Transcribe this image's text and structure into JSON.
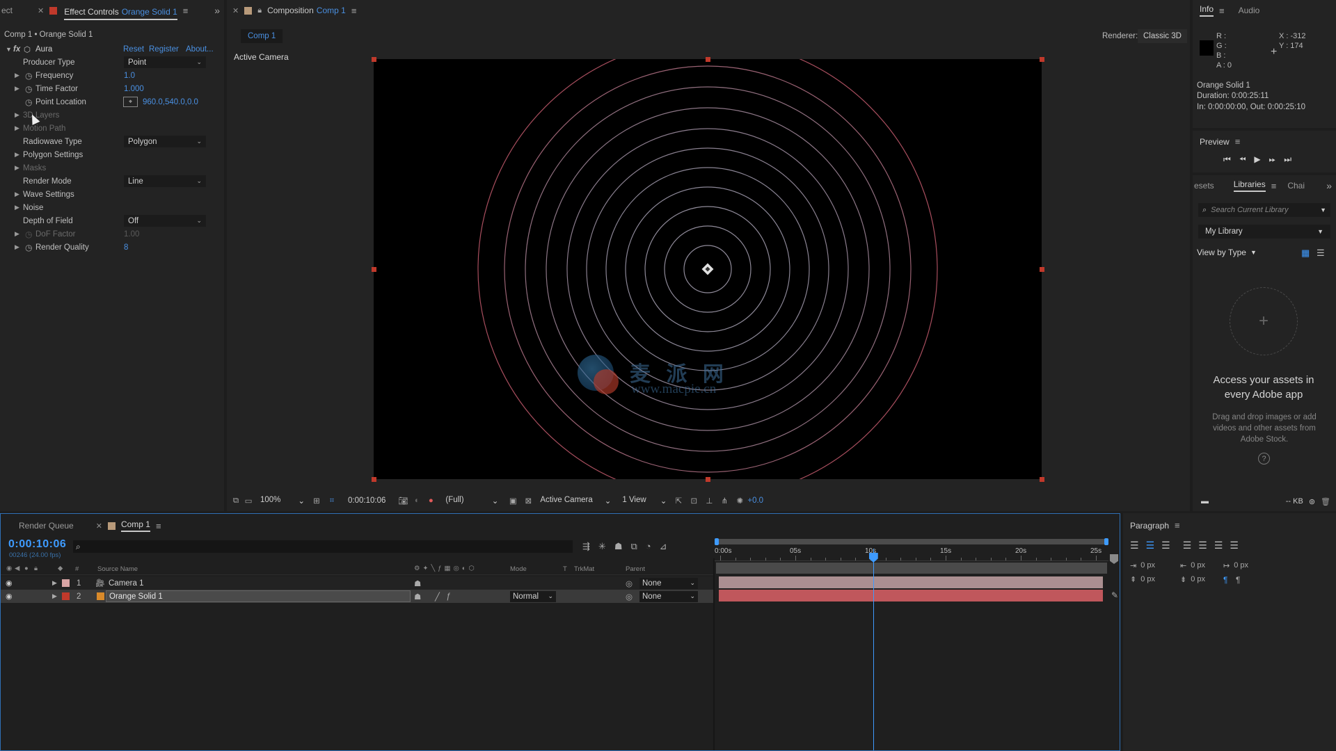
{
  "effect_controls": {
    "tabs": {
      "prev_tab": "ect",
      "title": "Effect Controls",
      "layer_name": "Orange Solid 1"
    },
    "breadcrumb": "Comp 1 • Orange Solid 1",
    "effect": {
      "name": "Aura",
      "reset": "Reset",
      "register": "Register",
      "about": "About..."
    },
    "params": {
      "producer_type": {
        "label": "Producer Type",
        "value": "Point"
      },
      "frequency": {
        "label": "Frequency",
        "value": "1.0"
      },
      "time_factor": {
        "label": "Time Factor",
        "value": "1.000"
      },
      "point_location": {
        "label": "Point Location",
        "value": "960.0,540.0,0.0"
      },
      "layers": {
        "label": "3D Layers"
      },
      "motion_path": {
        "label": "Motion Path"
      },
      "radiowave_type": {
        "label": "Radiowave Type",
        "value": "Polygon"
      },
      "polygon_settings": {
        "label": "Polygon Settings"
      },
      "masks": {
        "label": "Masks"
      },
      "render_mode": {
        "label": "Render Mode",
        "value": "Line"
      },
      "wave_settings": {
        "label": "Wave Settings"
      },
      "noise": {
        "label": "Noise"
      },
      "depth_of_field": {
        "label": "Depth of Field",
        "value": "Off"
      },
      "dof_factor": {
        "label": "DoF Factor",
        "value": "1.00"
      },
      "render_quality": {
        "label": "Render Quality",
        "value": "8"
      }
    }
  },
  "composition": {
    "tab_prefix": "Composition",
    "tab_name": "Comp 1",
    "flow_tab": "Comp 1",
    "renderer_label": "Renderer:",
    "renderer_value": "Classic 3D",
    "active_camera_label": "Active Camera",
    "watermark_title": "麦 派 网",
    "watermark_url": "www.macpie.cn",
    "footer": {
      "zoom": "100%",
      "timecode": "0:00:10:06",
      "resolution": "(Full)",
      "camera": "Active Camera",
      "views": "1 View",
      "exposure": "+0.0"
    }
  },
  "info": {
    "tab_info": "Info",
    "tab_audio": "Audio",
    "r_label": "R :",
    "g_label": "G :",
    "b_label": "B :",
    "a_label": "A : 0",
    "x": "X : -312",
    "y": "Y : 174",
    "layer_name": "Orange Solid 1",
    "duration": "Duration: 0:00:25:11",
    "in_out": "In: 0:00:00:00, Out: 0:00:25:10"
  },
  "preview": {
    "title": "Preview"
  },
  "libraries": {
    "tab_prev": "esets",
    "tab_active": "Libraries",
    "tab_next": "Chai",
    "search_placeholder": "Search Current Library",
    "library": "My Library",
    "view_by": "View by Type",
    "empty_title": "Access your assets in every Adobe app",
    "empty_body": "Drag and drop images or add videos and other assets from Adobe Stock.",
    "size": "-- KB"
  },
  "timeline": {
    "tab_render_queue": "Render Queue",
    "tab_comp": "Comp 1",
    "timecode": "0:00:10:06",
    "frame_info": "00246 (24.00 fps)",
    "headers": {
      "num": "#",
      "source": "Source Name",
      "mode": "Mode",
      "t": "T",
      "trkmat": "TrkMat",
      "parent": "Parent"
    },
    "ruler": [
      "0:00s",
      "05s",
      "10s",
      "15s",
      "20s",
      "25s"
    ],
    "layers": [
      {
        "num": "1",
        "name": "Camera 1",
        "mode": "",
        "parent": "None",
        "color": "#d9a5a5"
      },
      {
        "num": "2",
        "name": "Orange Solid 1",
        "mode": "Normal",
        "parent": "None",
        "color": "#d98a2a"
      }
    ],
    "playhead_fraction": 0.407
  },
  "paragraph": {
    "title": "Paragraph",
    "indent1": "0 px",
    "indent2": "0 px",
    "indent3": "0 px",
    "space1": "0 px",
    "space2": "0 px"
  }
}
